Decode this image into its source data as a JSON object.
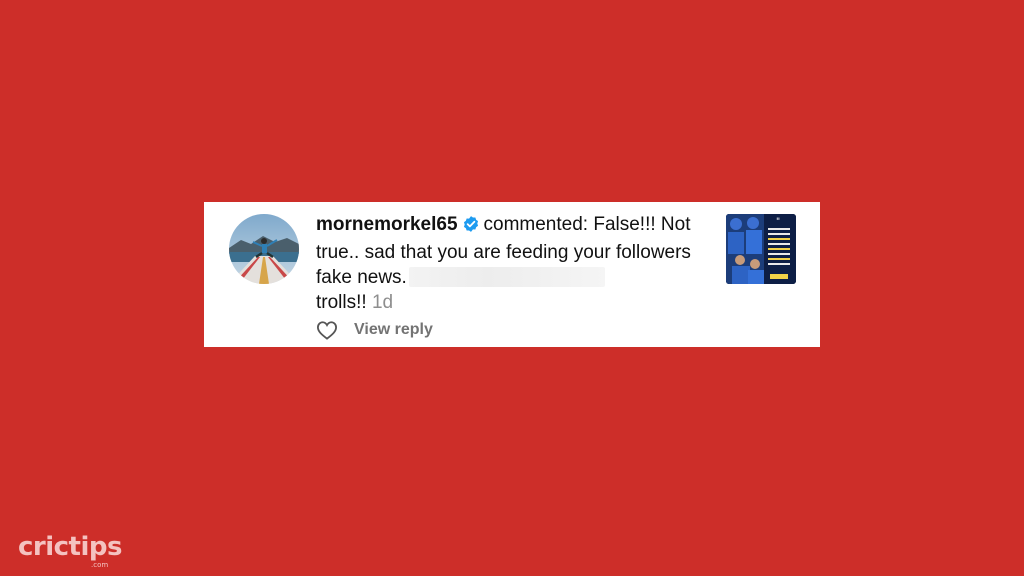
{
  "comment": {
    "username": "mornemorkel65",
    "action_text": "commented: False!!! Not true.. sad that you are feeding your followers fake news.",
    "text_tail": "trolls!!",
    "time": "1d",
    "verified_icon": "verified-badge-icon",
    "verified_color": "#1d9bf0"
  },
  "actions": {
    "like_icon": "heart-outline-icon",
    "view_reply_label": "View reply"
  },
  "branding": {
    "logo_text": "crictips",
    "logo_sub": ".com"
  },
  "colors": {
    "background": "#cd2e29",
    "card": "#ffffff"
  }
}
